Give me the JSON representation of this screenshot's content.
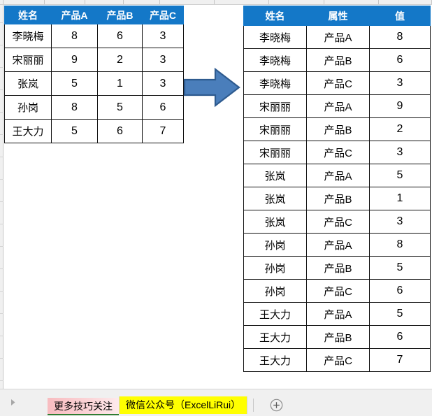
{
  "app": {
    "type": "spreadsheet"
  },
  "wide_table": {
    "name": "source-table",
    "headers": [
      "姓名",
      "产品A",
      "产品B",
      "产品C"
    ],
    "header_color": "#1478c8",
    "rows": [
      {
        "name": "李晓梅",
        "a": "8",
        "b": "6",
        "c": "3"
      },
      {
        "name": "宋丽丽",
        "a": "9",
        "b": "2",
        "c": "3"
      },
      {
        "name": "张岚",
        "a": "5",
        "b": "1",
        "c": "3"
      },
      {
        "name": "孙岗",
        "a": "8",
        "b": "5",
        "c": "6"
      },
      {
        "name": "王大力",
        "a": "5",
        "b": "6",
        "c": "7"
      }
    ]
  },
  "long_table": {
    "name": "unpivoted-table",
    "headers": [
      "姓名",
      "属性",
      "值"
    ],
    "header_color": "#1478c8",
    "rows": [
      {
        "name": "李晓梅",
        "attr": "产品A",
        "value": "8"
      },
      {
        "name": "李晓梅",
        "attr": "产品B",
        "value": "6"
      },
      {
        "name": "李晓梅",
        "attr": "产品C",
        "value": "3"
      },
      {
        "name": "宋丽丽",
        "attr": "产品A",
        "value": "9"
      },
      {
        "name": "宋丽丽",
        "attr": "产品B",
        "value": "2"
      },
      {
        "name": "宋丽丽",
        "attr": "产品C",
        "value": "3"
      },
      {
        "name": "张岚",
        "attr": "产品A",
        "value": "5"
      },
      {
        "name": "张岚",
        "attr": "产品B",
        "value": "1"
      },
      {
        "name": "张岚",
        "attr": "产品C",
        "value": "3"
      },
      {
        "name": "孙岗",
        "attr": "产品A",
        "value": "8"
      },
      {
        "name": "孙岗",
        "attr": "产品B",
        "value": "5"
      },
      {
        "name": "孙岗",
        "attr": "产品C",
        "value": "6"
      },
      {
        "name": "王大力",
        "attr": "产品A",
        "value": "5"
      },
      {
        "name": "王大力",
        "attr": "产品B",
        "value": "6"
      },
      {
        "name": "王大力",
        "attr": "产品C",
        "value": "7"
      }
    ]
  },
  "arrow": {
    "icon": "right-arrow-icon",
    "fill": "#4a7ebb",
    "stroke": "#2e5b8f"
  },
  "tab_bar": {
    "nav_icon": "tab-nav-right-icon",
    "add_icon": "add-sheet-icon",
    "tabs": [
      {
        "label": "更多技巧关注",
        "active": false,
        "color": "#f8bcc0"
      },
      {
        "label": "微信公众号（ExcelLiRui）",
        "active": true,
        "color": "#ffff00"
      }
    ]
  }
}
